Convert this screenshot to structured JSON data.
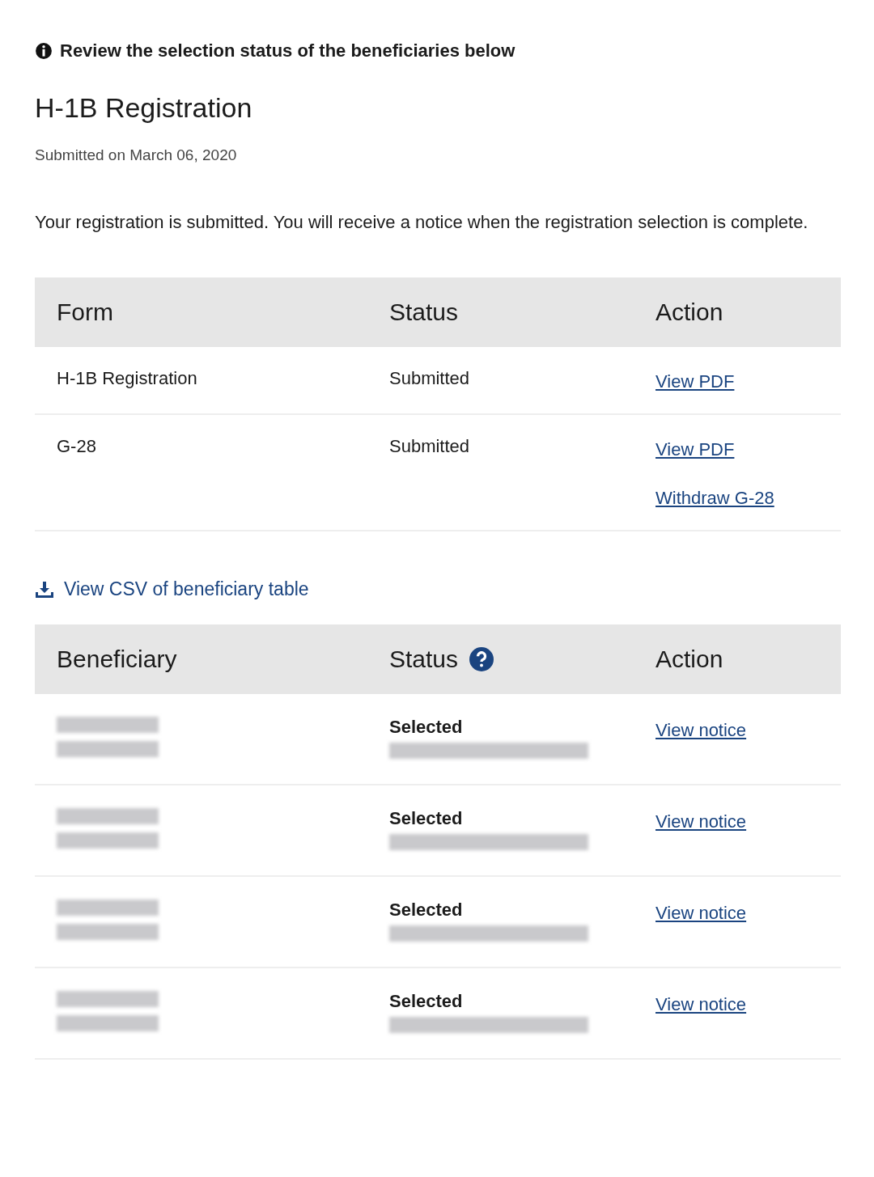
{
  "alert": {
    "text": "Review the selection status of the beneficiaries below"
  },
  "title": "H-1B Registration",
  "submitted": "Submitted on March 06, 2020",
  "message": "Your registration is submitted. You will receive a notice when the registration selection is complete.",
  "forms_table": {
    "columns": [
      "Form",
      "Status",
      "Action"
    ],
    "rows": [
      {
        "form": "H-1B Registration",
        "status": "Submitted",
        "actions": [
          "View PDF"
        ]
      },
      {
        "form": "G-28",
        "status": "Submitted",
        "actions": [
          "View PDF",
          "Withdraw G-28"
        ]
      }
    ]
  },
  "csv_link": "View CSV of beneficiary table",
  "beneficiary_table": {
    "columns": [
      "Beneficiary",
      "Status",
      "Action"
    ],
    "rows": [
      {
        "status": "Selected",
        "action": "View notice"
      },
      {
        "status": "Selected",
        "action": "View notice"
      },
      {
        "status": "Selected",
        "action": "View notice"
      },
      {
        "status": "Selected",
        "action": "View notice"
      }
    ]
  }
}
